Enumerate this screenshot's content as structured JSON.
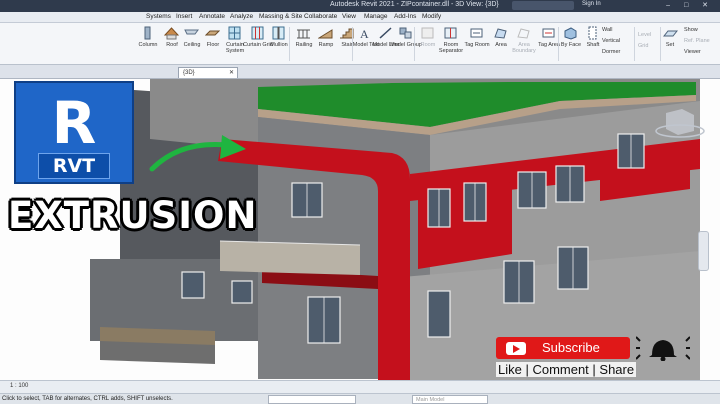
{
  "app": {
    "title": "Autodesk Revit 2021 - ZIPcontainer.dll - 3D View: {3D}",
    "search_placeholder": "",
    "sign_in": "Sign In",
    "window_controls": "–  □  ✕"
  },
  "menu_tabs": [
    "Systems",
    "Insert",
    "Annotate",
    "Analyze",
    "Massing & Site",
    "Collaborate",
    "View",
    "Manage",
    "Add-Ins",
    "Modify"
  ],
  "ribbon": {
    "tools": [
      {
        "label": "Column",
        "icon": "column-icon",
        "disabled": false
      },
      {
        "label": "Roof",
        "icon": "roof-icon",
        "disabled": false
      },
      {
        "label": "Ceiling",
        "icon": "ceiling-icon",
        "disabled": false
      },
      {
        "label": "Floor",
        "icon": "floor-icon",
        "disabled": false
      },
      {
        "label": "Curtain System",
        "icon": "curtain-system-icon",
        "disabled": false
      },
      {
        "label": "Curtain Grid",
        "icon": "curtain-grid-icon",
        "disabled": false
      },
      {
        "label": "Mullion",
        "icon": "mullion-icon",
        "disabled": false
      },
      {
        "label": "Railing",
        "icon": "railing-icon",
        "disabled": false
      },
      {
        "label": "Ramp",
        "icon": "ramp-icon",
        "disabled": false
      },
      {
        "label": "Stair",
        "icon": "stair-icon",
        "disabled": false
      },
      {
        "label": "Model Text",
        "icon": "model-text-icon",
        "disabled": false
      },
      {
        "label": "Model Line",
        "icon": "model-line-icon",
        "disabled": false
      },
      {
        "label": "Model Group",
        "icon": "model-group-icon",
        "disabled": false
      },
      {
        "label": "Room",
        "icon": "room-icon",
        "disabled": true
      },
      {
        "label": "Room Separator",
        "icon": "room-separator-icon",
        "disabled": false
      },
      {
        "label": "Tag Room",
        "icon": "tag-room-icon",
        "disabled": false
      },
      {
        "label": "Area",
        "icon": "area-icon",
        "disabled": false
      },
      {
        "label": "Area Boundary",
        "icon": "area-boundary-icon",
        "disabled": true
      },
      {
        "label": "Tag Area",
        "icon": "tag-area-icon",
        "disabled": false
      },
      {
        "label": "By Face",
        "icon": "by-face-icon",
        "disabled": false
      },
      {
        "label": "Shaft",
        "icon": "shaft-icon",
        "disabled": false
      }
    ],
    "opening_small": [
      "Wall",
      "Vertical",
      "Dormer"
    ],
    "datum_small": [
      "Level",
      "Grid"
    ],
    "set_label": "Set",
    "workplane_small": [
      "Show",
      "Ref. Plane",
      "Viewer"
    ]
  },
  "view_tab": "{3D}",
  "overlay": {
    "logo_letter": "R",
    "logo_text": "RVT",
    "headline": "EXTRUSION",
    "subscribe": "Subscribe",
    "social": "Like | Comment | Share"
  },
  "view_control": {
    "scale": "1 : 100"
  },
  "status": {
    "message": "Click to select, TAB for alternates, CTRL adds, SHIFT unselects.",
    "model": "Main Model"
  },
  "colors": {
    "accent_red": "#c4101c",
    "roof_green": "#1f8c2b",
    "wall_gray": "#9a9a9a",
    "revit_blue": "#1f66c8",
    "youtube_red": "#e01818"
  }
}
